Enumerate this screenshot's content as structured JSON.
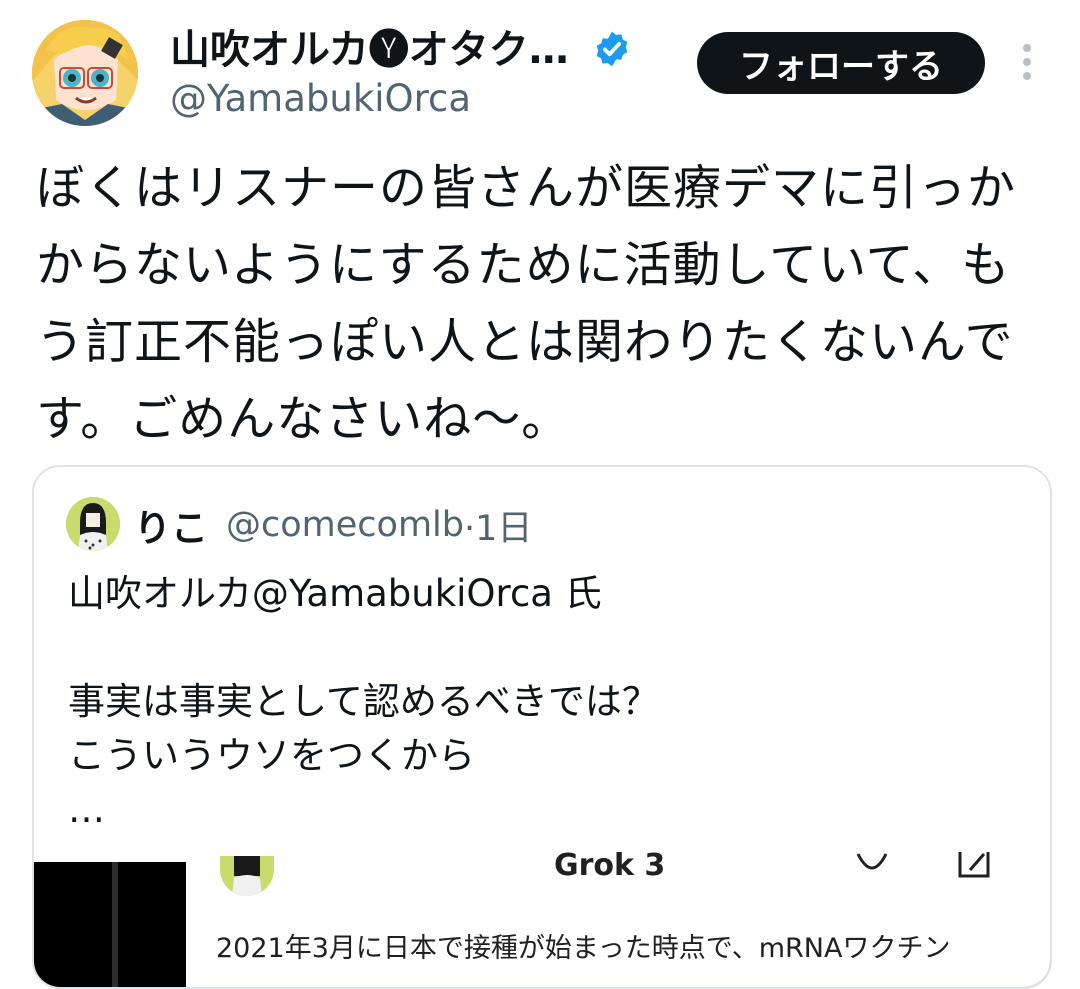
{
  "author": {
    "display_name": "山吹オルカ🅨オタク…",
    "handle": "@YamabukiOrca",
    "avatar_icon": "anime-avatar-icon",
    "verified_icon": "verified-badge-icon"
  },
  "actions": {
    "follow_label": "フォローする",
    "more_icon": "more-vertical-icon"
  },
  "tweet": {
    "lines": [
      "ぼくはリスナーの皆さんが医療デマに引っか",
      "からないようにするために活動していて、も",
      "う訂正不能っぽい人とは関わりたくないんで",
      "す。ごめんなさいね〜。"
    ]
  },
  "quoted": {
    "name": "りこ",
    "handle": "@comecomlb",
    "time": "·1日",
    "lines": [
      "山吹オルカ@YamabukiOrca 氏",
      "",
      "事実は事実として認めるべきでは？",
      "こういうウソをつくから",
      "…"
    ],
    "media": {
      "title": "Grok 3",
      "text": "2021年3月に日本で接種が始まった時点で、mRNAワクチン"
    }
  },
  "colors": {
    "text": "#0f1419",
    "secondary": "#536471",
    "verified": "#1d9bf0",
    "button_bg": "#0f1419",
    "border": "#dfe3e6"
  }
}
